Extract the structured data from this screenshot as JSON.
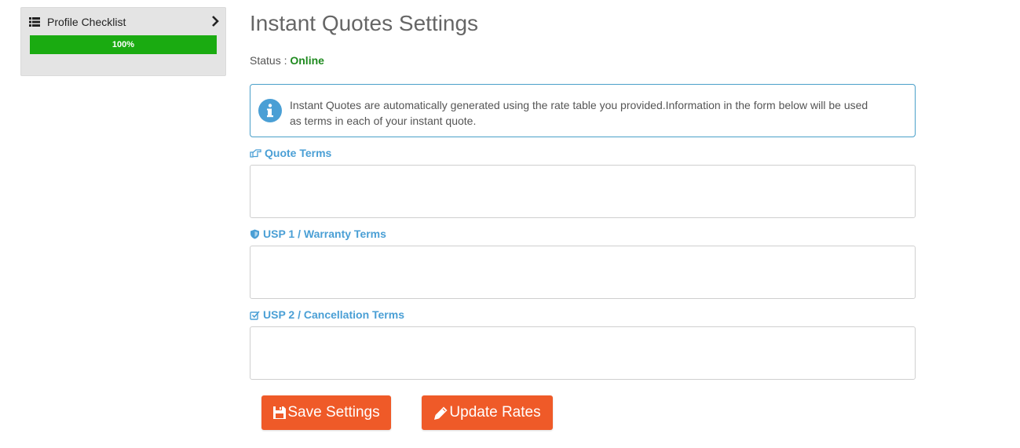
{
  "sidebar": {
    "checklist_title": "Profile Checklist",
    "progress_label": "100%",
    "progress_value": 1.0,
    "progress_color": "#1aab11"
  },
  "main": {
    "title": "Instant Quotes Settings",
    "status_label": "Status :",
    "status_value": "Online",
    "info_message": "Instant Quotes are automatically generated using the rate table you provided.Information in the form below will be used as terms in each of your instant quote.",
    "fields": [
      {
        "label": "Quote Terms",
        "icon": "hand-point-right-icon",
        "value": ""
      },
      {
        "label": "USP 1 / Warranty Terms",
        "icon": "shield-icon",
        "value": ""
      },
      {
        "label": "USP 2 / Cancellation Terms",
        "icon": "check-square-icon",
        "value": ""
      }
    ],
    "buttons": {
      "save_label": "Save Settings",
      "update_label": "Update Rates"
    }
  },
  "colors": {
    "accent": "#ef5a28",
    "label_blue": "#4a9fd5",
    "status_green": "#1f8a1f",
    "info_border": "#4aa0c9"
  }
}
